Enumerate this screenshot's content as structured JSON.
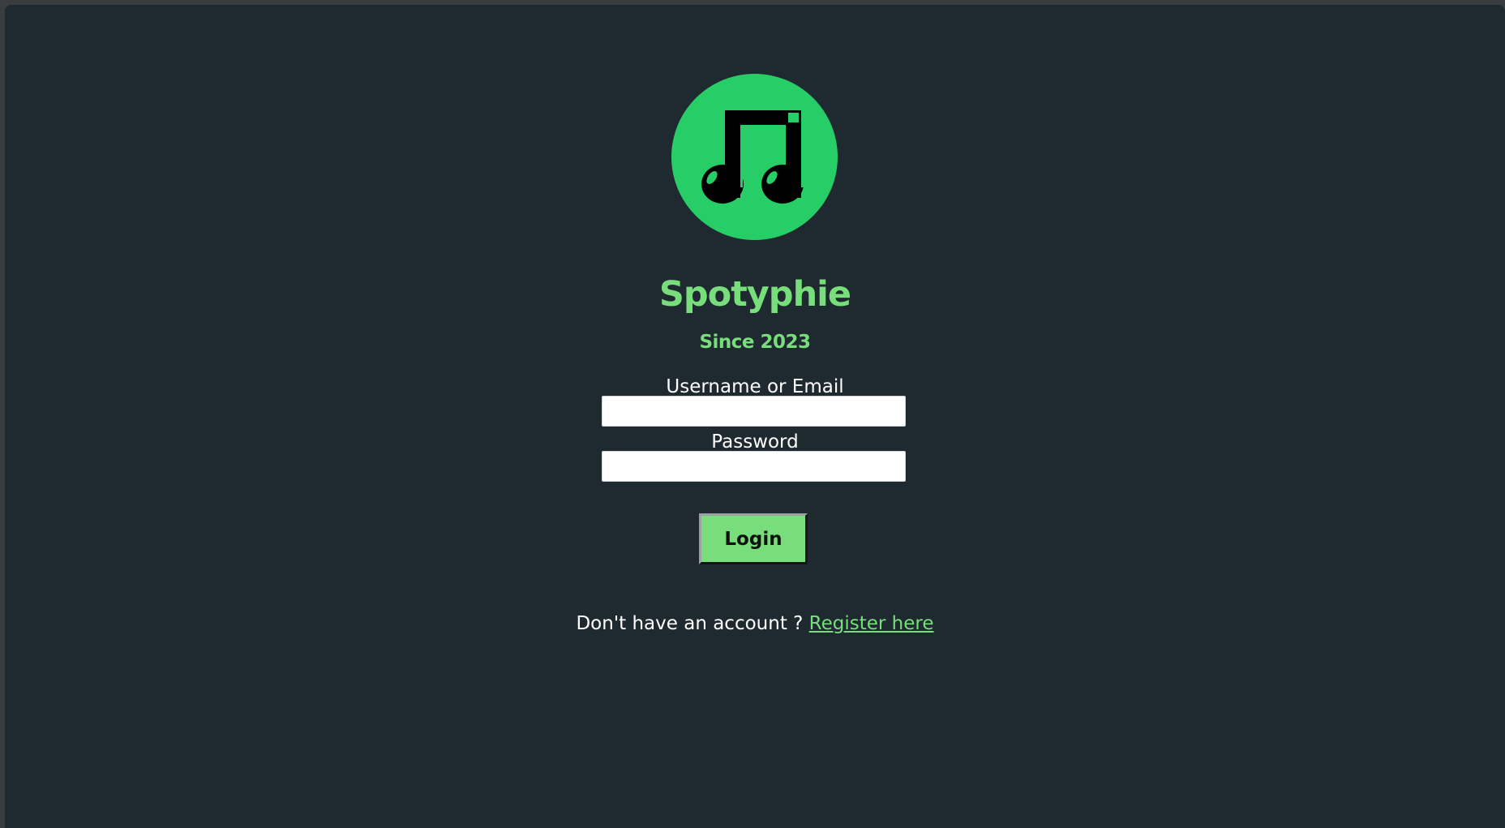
{
  "app": {
    "title": "Spotyphie",
    "subtitle": "Since 2023"
  },
  "colors": {
    "background": "#1f2930",
    "brand_green": "#27ce67",
    "accent_green": "#78de7b",
    "text_white": "#ffffff",
    "logo_ink": "#000000"
  },
  "logo": {
    "icon": "music-notes-icon"
  },
  "form": {
    "username_label": "Username or Email",
    "username_value": "",
    "password_label": "Password",
    "password_value": "",
    "login_label": "Login"
  },
  "register": {
    "prompt": "Don't have an account ?",
    "link_label": "Register here"
  }
}
